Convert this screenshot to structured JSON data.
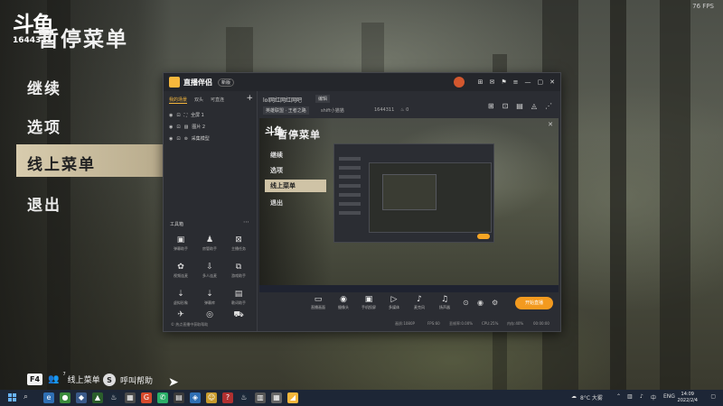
{
  "game": {
    "fps": "76 FPS",
    "logo_mark": "斗鱼",
    "room_id": "1644311",
    "pause_title": "暂停菜单",
    "menu": [
      "继续",
      "选项",
      "线上菜单",
      "退出"
    ],
    "active_index": 2,
    "hints": {
      "key_f4": "F4",
      "online_menu": "线上菜单",
      "online_menu_key_hint": "7",
      "help_key": "S",
      "help": "呼叫帮助"
    }
  },
  "app": {
    "name": "直播伴侣",
    "badge": "新版",
    "sidebar_tabs": [
      "我的场景",
      "双头",
      "可直连"
    ],
    "add_label": "+",
    "scenes": [
      {
        "label": "全屏 1"
      },
      {
        "label": "图片 2"
      },
      {
        "label": "采集模型"
      }
    ],
    "tools_title": "工具箱",
    "tools_more": "⋯",
    "tools": [
      {
        "icon": "▣",
        "label": "弹幕助手"
      },
      {
        "icon": "♟",
        "label": "房管助手"
      },
      {
        "icon": "⊠",
        "label": "主播任务"
      },
      {
        "icon": "✿",
        "label": "视频连麦"
      },
      {
        "icon": "⇩",
        "label": "多人连麦"
      },
      {
        "icon": "⧉",
        "label": "游戏助手"
      },
      {
        "icon": "⇣",
        "label": "虚拟形象"
      },
      {
        "icon": "⇣",
        "label": "弹幕库"
      },
      {
        "icon": "▤",
        "label": "歌词助手"
      },
      {
        "icon": "✈",
        "label": ""
      },
      {
        "icon": "◎",
        "label": ""
      },
      {
        "icon": "⛟",
        "label": ""
      }
    ],
    "help_line": "© 热点直播中获取帮助",
    "room_title": "lol网红网红网吧",
    "room_edit": "编辑",
    "room_category": "英雄联盟 · 王者之路",
    "room_user": "shift小猫猫",
    "room_fans": "1644311",
    "room_likes": "0",
    "preview": {
      "logo": "斗鱼",
      "title": "暂停菜单",
      "menu": [
        "继续",
        "选项",
        "线上菜单",
        "退出"
      ]
    },
    "controls": [
      {
        "icon": "▭",
        "label": "直播画面"
      },
      {
        "icon": "◉",
        "label": "摄像头"
      },
      {
        "icon": "▣",
        "label": "手机投屏"
      },
      {
        "icon": "▷",
        "label": "多媒体"
      },
      {
        "icon": "♪",
        "label": "麦克风"
      },
      {
        "icon": "♫",
        "label": "扬声器"
      }
    ],
    "start_label": "开始直播",
    "status": {
      "bitrate": "画质:1080P",
      "fps": "FPS:60",
      "dropped": "丢帧率:0.00%",
      "cpu": "CPU:25%",
      "memory": "内存:40%",
      "time": "00:00:00"
    }
  },
  "taskbar": {
    "weather": "8°C 大雾",
    "lang": "ENG",
    "time": "14:09",
    "date": "2022/2/4"
  }
}
